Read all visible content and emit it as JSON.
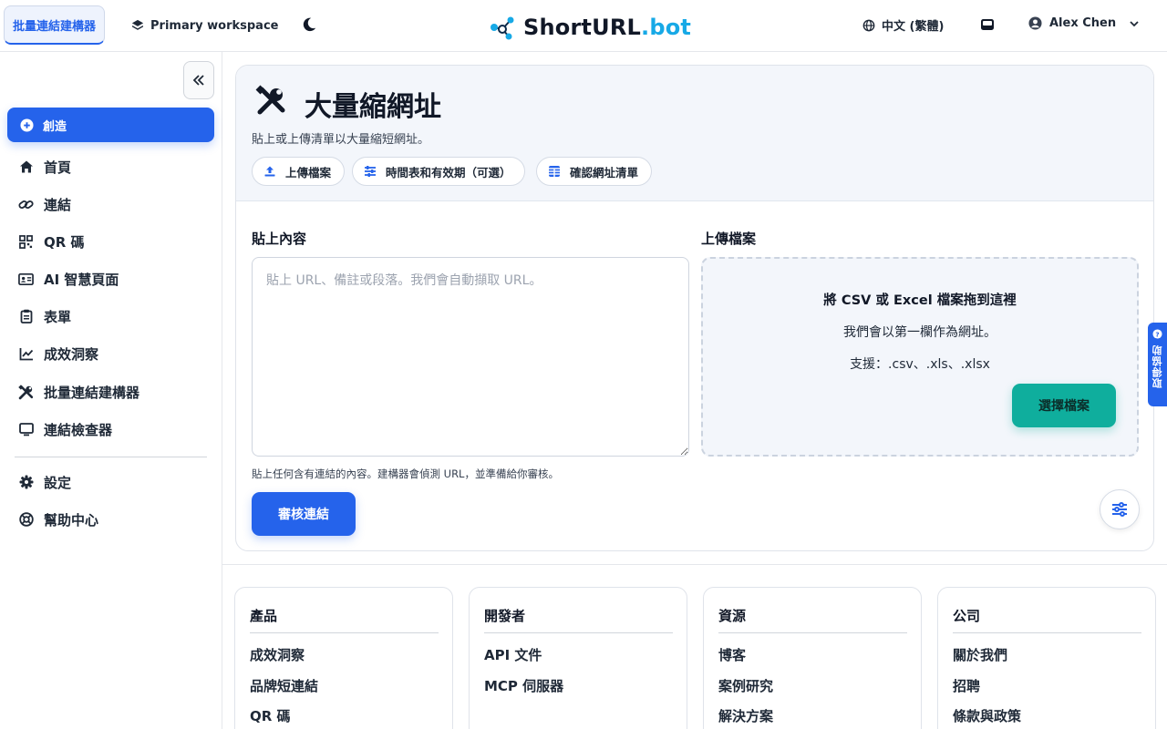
{
  "topbar": {
    "active_tab": "批量連結建構器",
    "workspace": "Primary workspace",
    "logo_prefix": "ShortURL",
    "logo_suffix": ".bot",
    "language": "中文 (繁體)",
    "user_name": "Alex Chen"
  },
  "sidebar": {
    "create_label": "創造",
    "items": [
      {
        "label": "首頁",
        "icon": "home-icon"
      },
      {
        "label": "連結",
        "icon": "link-icon"
      },
      {
        "label": "QR 碼",
        "icon": "qr-code-icon"
      },
      {
        "label": "AI 智慧頁面",
        "icon": "id-card-icon"
      },
      {
        "label": "表單",
        "icon": "clipboard-icon"
      },
      {
        "label": "成效洞察",
        "icon": "chart-line-icon"
      },
      {
        "label": "批量連結建構器",
        "icon": "tools-icon"
      },
      {
        "label": "連結檢查器",
        "icon": "monitor-icon"
      }
    ],
    "bottom_items": [
      {
        "label": "設定",
        "icon": "gear-icon"
      },
      {
        "label": "幫助中心",
        "icon": "lifebuoy-icon"
      }
    ]
  },
  "main": {
    "title": "大量縮網址",
    "subtitle": "貼上或上傳清單以大量縮短網址。",
    "pills": [
      "上傳檔案",
      "時間表和有效期（可選）",
      "確認網址清單"
    ],
    "paste_label": "貼上內容",
    "paste_placeholder": "貼上 URL、備註或段落。我們會自動擷取 URL。",
    "paste_helper": "貼上任何含有連結的內容。建構器會偵測 URL，並準備給你審核。",
    "review_button": "審核連結",
    "upload_label": "上傳檔案",
    "dropzone_title": "將 CSV 或 Excel 檔案拖到這裡",
    "dropzone_line1": "我們會以第一欄作為網址。",
    "dropzone_line2": "支援：.csv、.xls、.xlsx",
    "choose_button": "選擇檔案"
  },
  "feedback_tab": "取得協助",
  "footer": {
    "columns": [
      {
        "title": "產品",
        "links": [
          "成效洞察",
          "品牌短連結",
          "QR 碼"
        ]
      },
      {
        "title": "開發者",
        "links": [
          "API 文件",
          "MCP 伺服器"
        ]
      },
      {
        "title": "資源",
        "links": [
          "博客",
          "案例研究",
          "解決方案"
        ]
      },
      {
        "title": "公司",
        "links": [
          "關於我們",
          "招聘",
          "條款與政策"
        ]
      }
    ]
  },
  "colors": {
    "accent": "#2563eb",
    "teal": "#0fae9d",
    "logo_dot": "#17a9e6"
  }
}
